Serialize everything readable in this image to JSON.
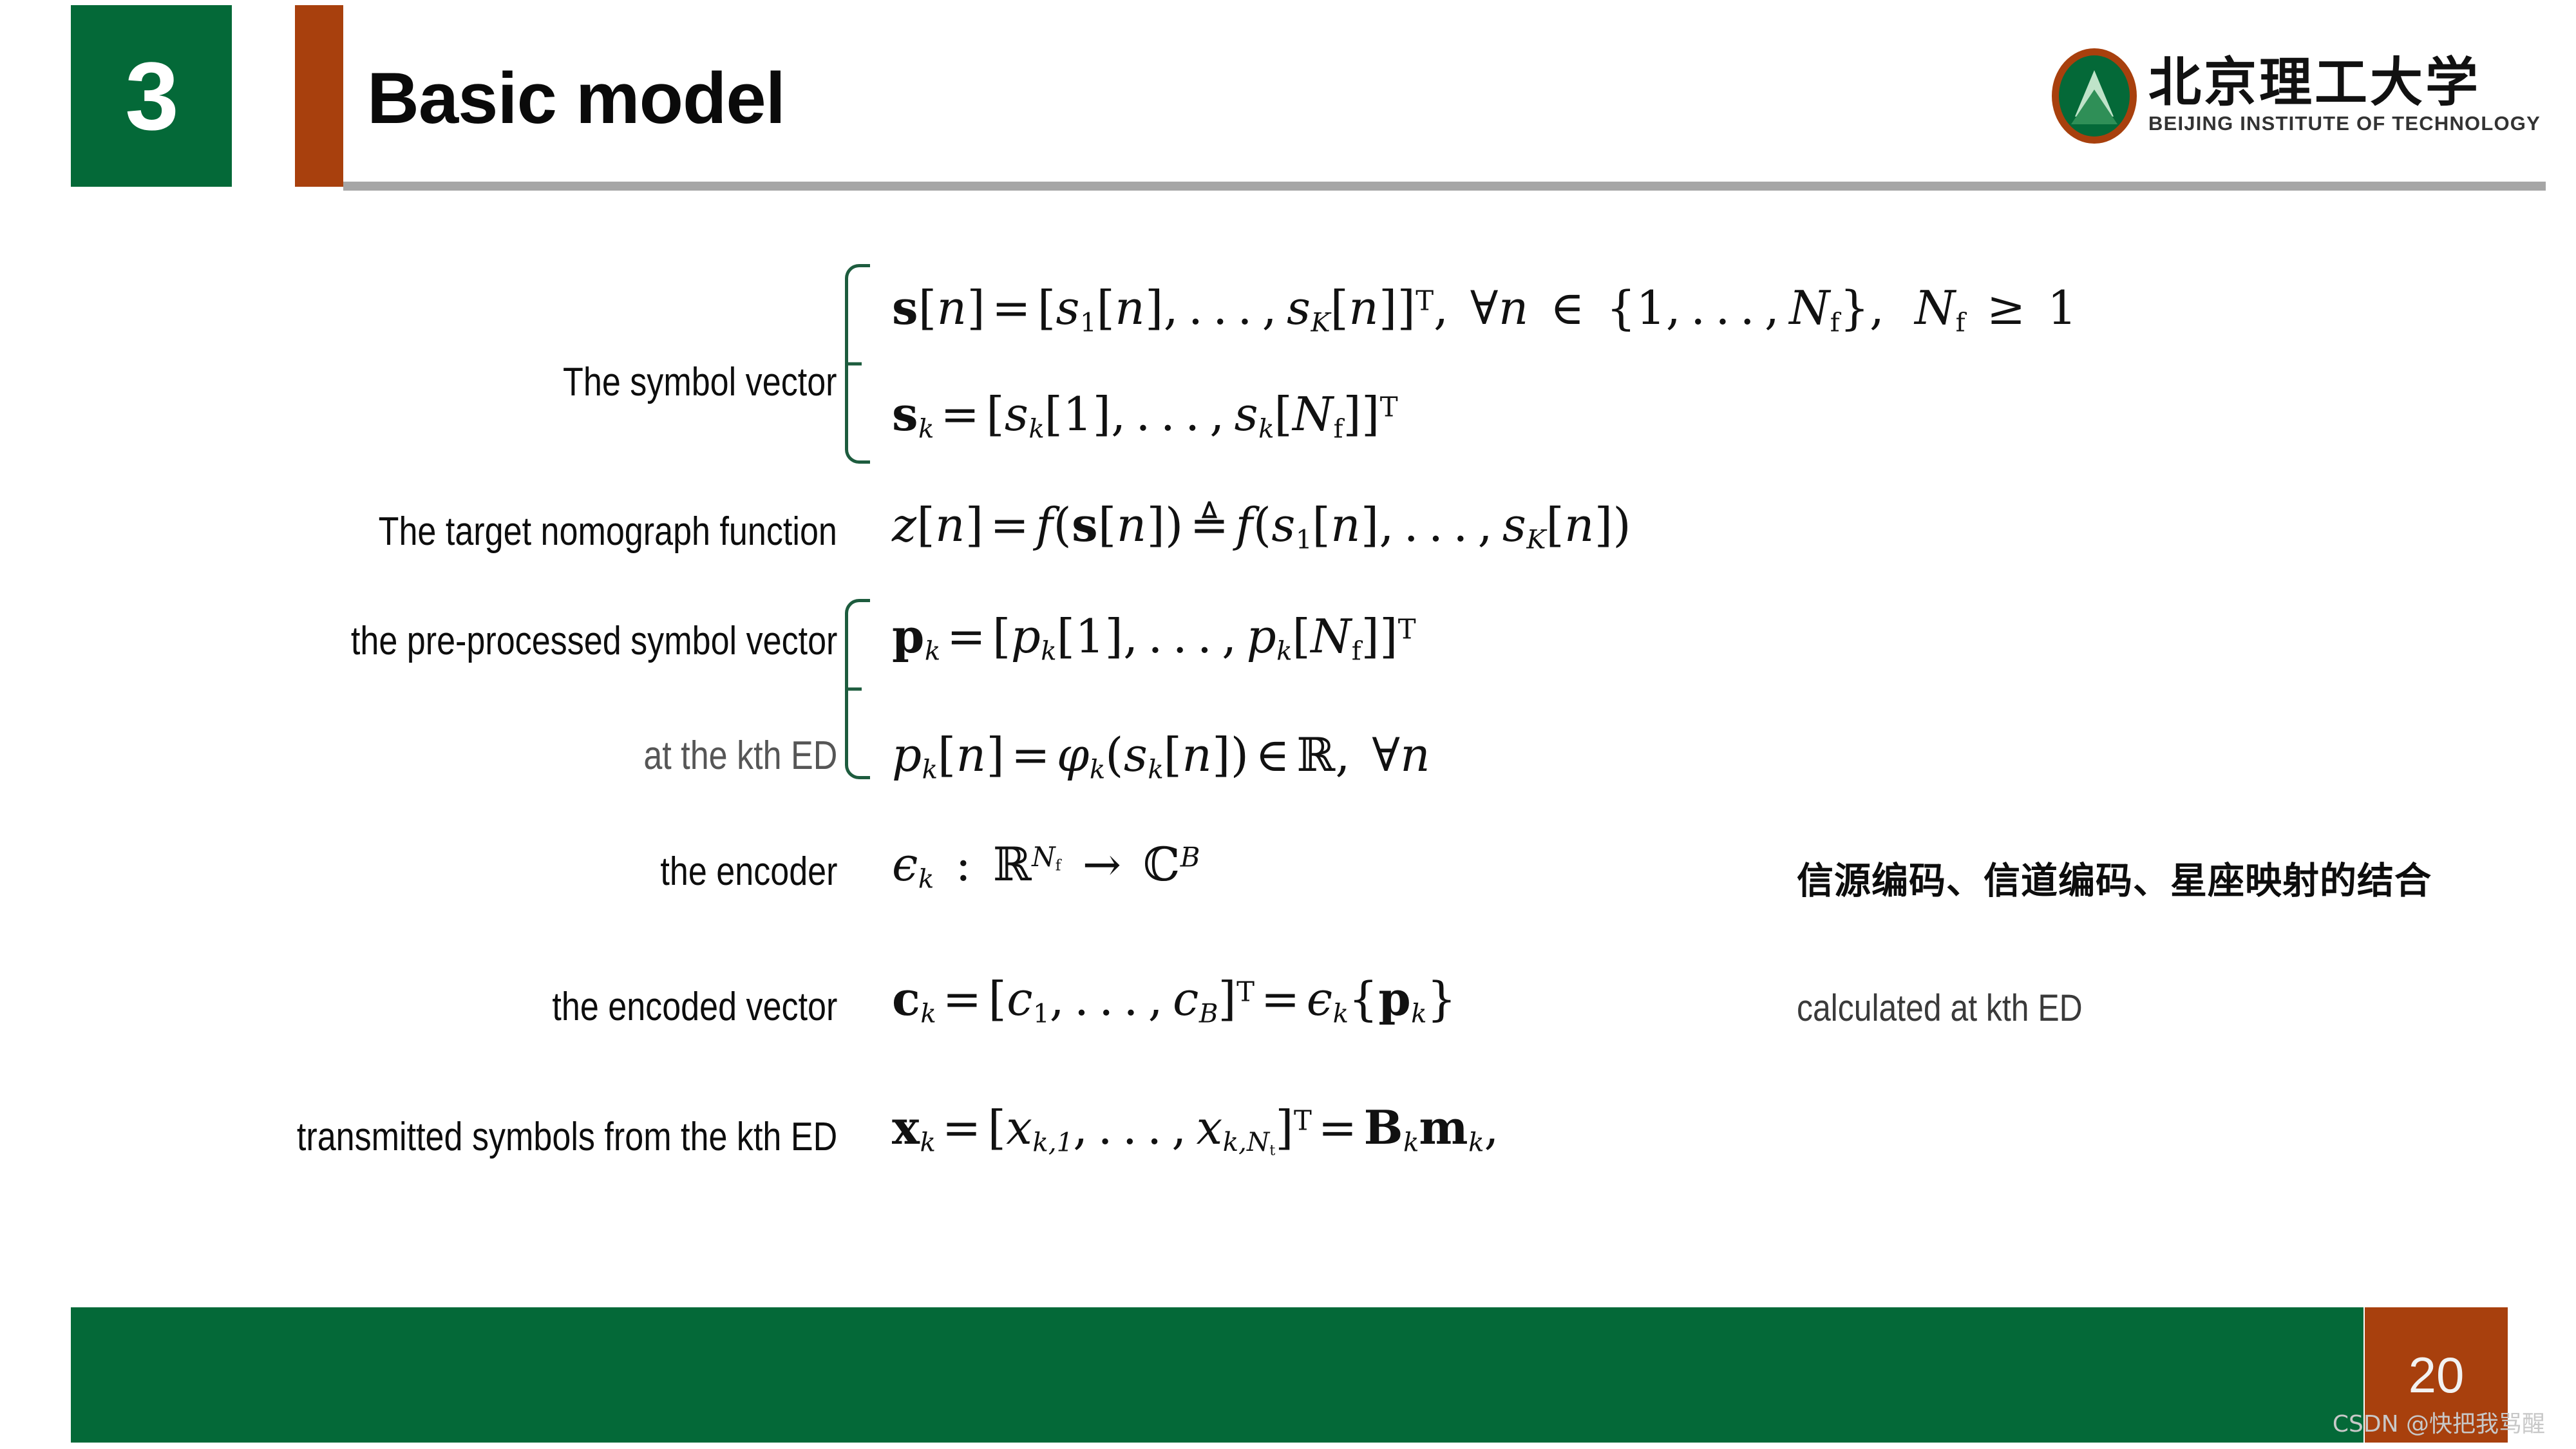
{
  "header": {
    "section_number": "3",
    "title": "Basic model",
    "logo": {
      "name_cn": "北京理工大学",
      "name_en": "BEIJING INSTITUTE OF TECHNOLOGY",
      "seal_icon": "university-seal-icon"
    },
    "colors": {
      "green": "#046938",
      "orange": "#a8400d",
      "rule": "#a6a6a6"
    }
  },
  "rows": [
    {
      "label": "The symbol vector",
      "label_color": "#0d0d0d",
      "grouped": true,
      "equations": [
        "s[n] = [s_1[n], ..., s_K[n]]^T,  ∀n ∈ {1, ..., N_f},  N_f ≥ 1",
        "s_k = [s_k[1], ..., s_k[N_f]]^T"
      ]
    },
    {
      "label": "The target nomograph function",
      "label_color": "#0d0d0d",
      "grouped": false,
      "equations": [
        "z[n] = f(s[n]) ≜ f(s_1[n], ..., s_K[n])"
      ]
    },
    {
      "label": "the pre-processed symbol vector",
      "label2": "at the kth ED",
      "label_color": "#0d0d0d",
      "label2_color": "#565656",
      "grouped": true,
      "equations": [
        "p_k = [p_k[1], ..., p_k[N_f]]^T",
        "p_k[n] = φ_k(s_k[n]) ∈ ℝ,  ∀n"
      ]
    },
    {
      "label": "the encoder",
      "label_color": "#0d0d0d",
      "grouped": false,
      "equations": [
        "ϵ_k : ℝ^{N_f} → ℂ^B"
      ],
      "note_cn": "信源编码、信道编码、星座映射的结合"
    },
    {
      "label": "the encoded vector",
      "label_color": "#0d0d0d",
      "grouped": false,
      "equations": [
        "c_k = [c_1, ..., c_B]^T = ϵ_k{p_k}"
      ],
      "note": "calculated at kth ED"
    },
    {
      "label": "transmitted symbols from the kth ED",
      "label_color": "#0d0d0d",
      "grouped": false,
      "equations": [
        "x_k = [x_{k,1}, ..., x_{k,N_t}]^T = B_k m_k,"
      ]
    }
  ],
  "footer": {
    "page_number": "20",
    "watermark": "CSDN @快把我骂醒",
    "colors": {
      "green": "#046938",
      "orange": "#a8400d"
    }
  }
}
